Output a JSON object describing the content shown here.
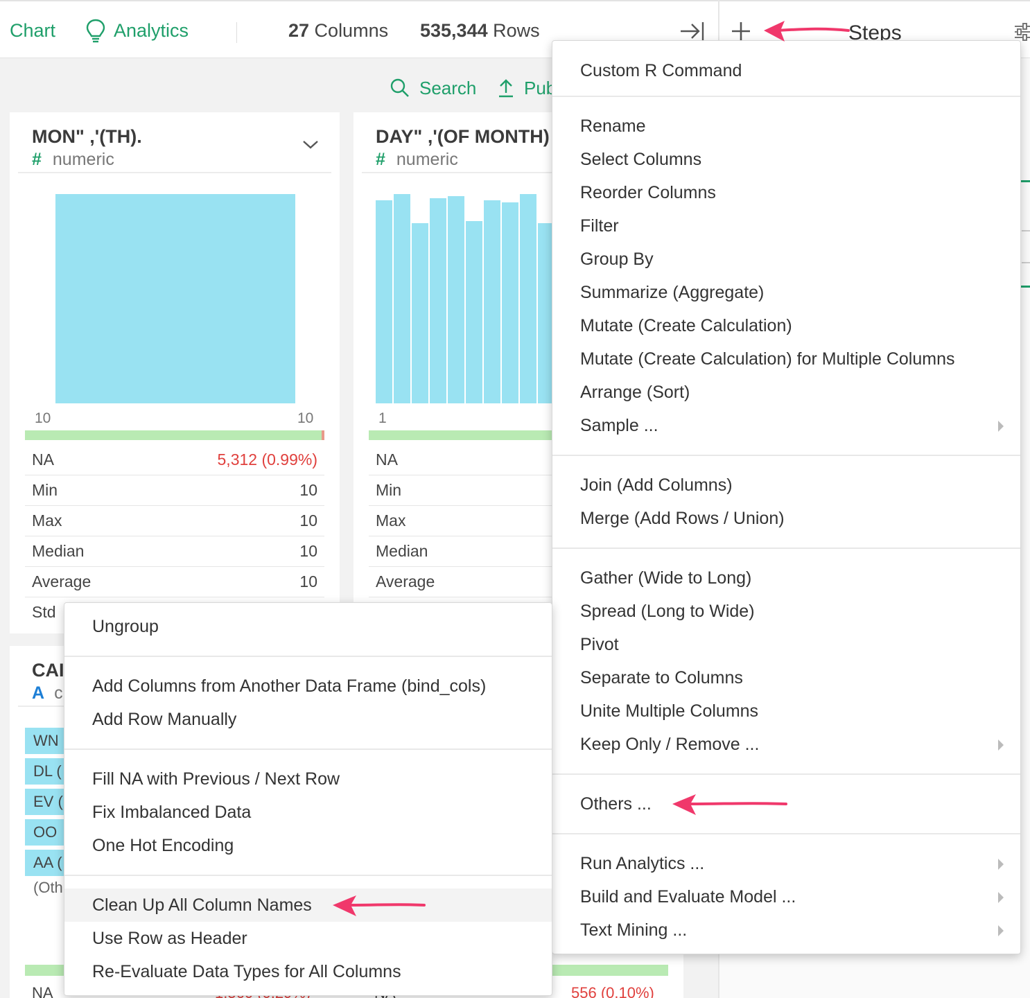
{
  "topbar": {
    "chart_label": "Chart",
    "analytics_label": "Analytics",
    "columns_count": "27",
    "columns_label": " Columns",
    "rows_count": "535,344",
    "rows_label": " Rows",
    "steps_label": "Steps"
  },
  "subtoolbar": {
    "search_label": "Search",
    "publish_label": "Pub"
  },
  "columns": [
    {
      "title": "MON\" ,'(TH).",
      "type": "numeric",
      "axis_min": "10",
      "axis_max": "10",
      "stats": [
        {
          "key": "NA",
          "value": "5,312 (0.99%)"
        },
        {
          "key": "Min",
          "value": "10"
        },
        {
          "key": "Max",
          "value": "10"
        },
        {
          "key": "Median",
          "value": "10"
        },
        {
          "key": "Average",
          "value": "10"
        },
        {
          "key": "Std",
          "value": ""
        }
      ]
    },
    {
      "title": "DAY\" ,'(OF MONTH)",
      "type": "numeric",
      "axis_min": "1",
      "stats": [
        {
          "key": "NA"
        },
        {
          "key": "Min"
        },
        {
          "key": "Max"
        },
        {
          "key": "Median"
        },
        {
          "key": "Average"
        }
      ]
    },
    {
      "title": "CAI",
      "type_letter": "A",
      "type": "c",
      "categories": [
        "WN",
        "DL (",
        "EV (",
        "OO",
        "AA ("
      ],
      "other_label": "(Oth",
      "na_label": "NA",
      "na_label_2": "NA",
      "na_value_left": "1,560 (0.29%)",
      "na_value": "556 (0.10%)"
    }
  ],
  "main_menu": {
    "items": [
      "Custom R Command",
      "Rename",
      "Select Columns",
      "Reorder Columns",
      "Filter",
      "Group By",
      "Summarize (Aggregate)",
      "Mutate (Create Calculation)",
      "Mutate (Create Calculation) for Multiple Columns",
      "Arrange (Sort)",
      "Sample ...",
      "Join (Add Columns)",
      "Merge (Add Rows / Union)",
      "Gather (Wide to Long)",
      "Spread (Long to Wide)",
      "Pivot",
      "Separate to Columns",
      "Unite Multiple Columns",
      "Keep Only / Remove ...",
      "Others ...",
      "Run Analytics ...",
      "Build and Evaluate Model ...",
      "Text Mining ..."
    ]
  },
  "sub_menu": {
    "items": [
      "Ungroup",
      "Add Columns from Another Data Frame (bind_cols)",
      "Add Row Manually",
      "Fill NA with Previous / Next Row",
      "Fix Imbalanced Data",
      "One Hot Encoding",
      "Clean Up All Column Names",
      "Use Row as Header",
      "Re-Evaluate Data Types for All Columns"
    ],
    "highlighted_item": "Clean Up All Column Names"
  },
  "colors": {
    "accent": "#1f9f6a",
    "histogram": "#99e2f2",
    "na_bar": "#b9eab3",
    "na_value": "#e0403d",
    "annotation_arrow": "#f0386b"
  },
  "icons": [
    "lightbulb-icon",
    "search-icon",
    "upload-icon",
    "expand-right-icon",
    "plus-icon",
    "settings-sliders-icon",
    "chevron-down-icon",
    "submenu-caret-icon"
  ],
  "chart_data": {
    "type": "bar",
    "histograms": [
      {
        "column": "MON\" ,'(TH).",
        "bins": 1,
        "relative_heights": [
          1.0
        ],
        "na_fraction": 0.0099
      },
      {
        "column": "DAY\" ,'(OF MONTH)",
        "relative_heights_visible": [
          0.97,
          1.0,
          0.86,
          0.98,
          0.99,
          0.87,
          0.97,
          0.96,
          1.0,
          0.86
        ]
      }
    ]
  }
}
